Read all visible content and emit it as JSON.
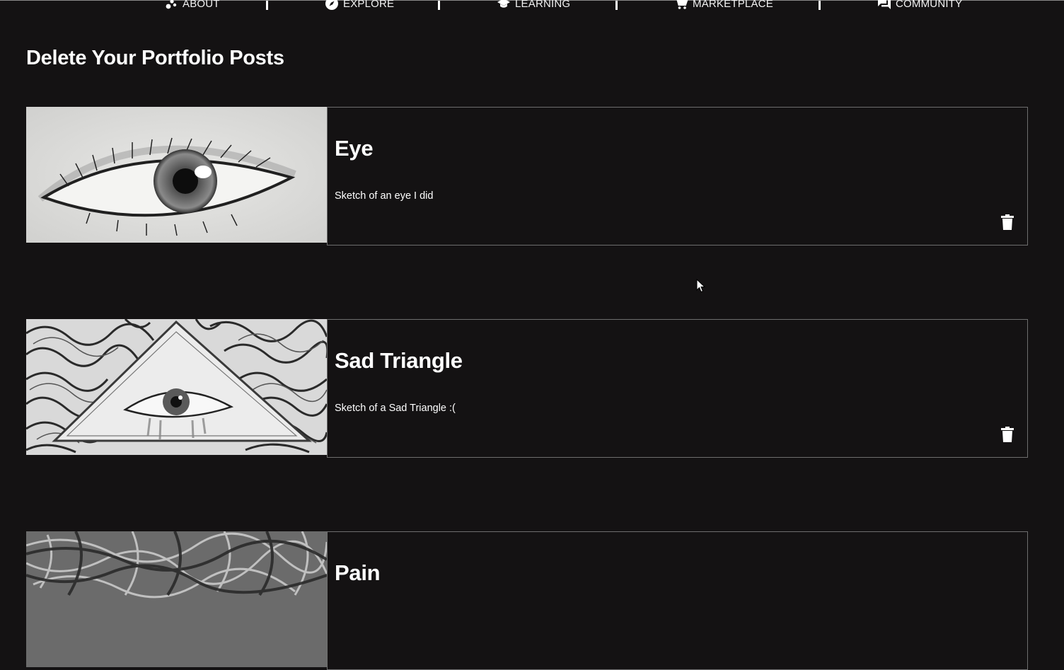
{
  "nav": {
    "items": [
      {
        "label": "ABOUT",
        "icon": "scatter-dots-icon"
      },
      {
        "label": "EXPLORE",
        "icon": "compass-icon"
      },
      {
        "label": "LEARNING",
        "icon": "school-icon"
      },
      {
        "label": "MARKETPLACE",
        "icon": "cart-icon"
      },
      {
        "label": "COMMUNITY",
        "icon": "forum-icon"
      }
    ]
  },
  "page": {
    "title": "Delete Your Portfolio Posts"
  },
  "posts": [
    {
      "title": "Eye",
      "description": "Sketch of an eye I did",
      "action_icon": "trash-icon"
    },
    {
      "title": "Sad Triangle",
      "description": "Sketch of a Sad Triangle :(",
      "action_icon": "trash-icon"
    },
    {
      "title": "Pain",
      "description": "",
      "action_icon": "trash-icon"
    }
  ],
  "colors": {
    "background": "#141213",
    "text": "#ffffff",
    "card_border": "#6e6e6e"
  }
}
